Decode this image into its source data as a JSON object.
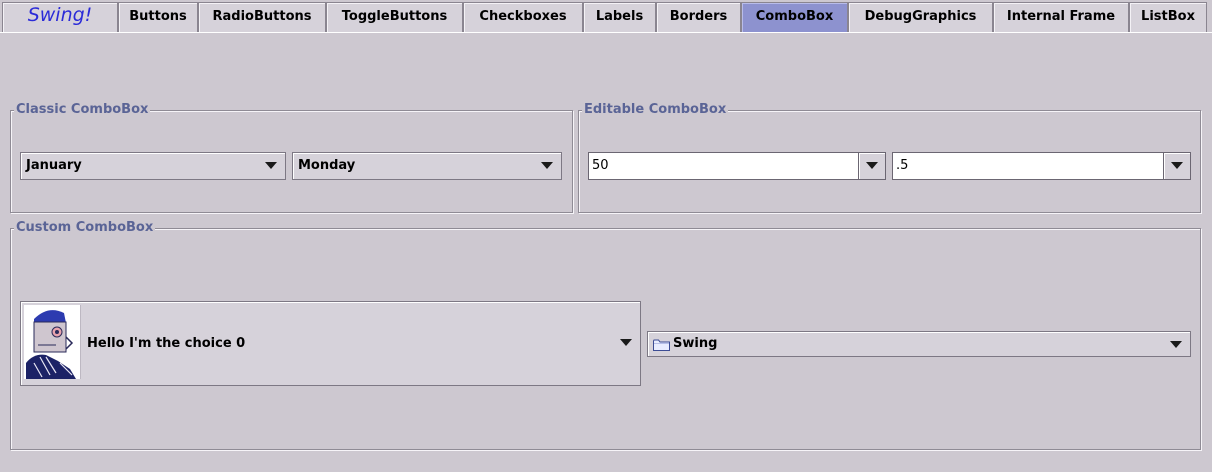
{
  "tabs": [
    {
      "label": "Swing!",
      "selected": false
    },
    {
      "label": "Buttons",
      "selected": false
    },
    {
      "label": "RadioButtons",
      "selected": false
    },
    {
      "label": "ToggleButtons",
      "selected": false
    },
    {
      "label": "Checkboxes",
      "selected": false
    },
    {
      "label": "Labels",
      "selected": false
    },
    {
      "label": "Borders",
      "selected": false
    },
    {
      "label": "ComboBox",
      "selected": true
    },
    {
      "label": "DebugGraphics",
      "selected": false
    },
    {
      "label": "Internal Frame",
      "selected": false
    },
    {
      "label": "ListBox",
      "selected": false
    }
  ],
  "classic": {
    "title": "Classic ComboBox",
    "month_value": "January",
    "day_value": "Monday"
  },
  "editable": {
    "title": "Editable ComboBox",
    "first_value": "50",
    "second_value": ".5"
  },
  "custom": {
    "title": "Custom ComboBox",
    "choice_value": "Hello I'm the choice 0",
    "folder_value": "Swing"
  },
  "icons": {
    "dropdown": "chevron-down-icon",
    "avatar": "robot-avatar-icon",
    "folder": "folder-icon"
  },
  "colors": {
    "background": "#cdc8d0",
    "selected_tab": "#8d92cf",
    "group_title": "#5a6496",
    "brand_text": "#2b2bd8"
  }
}
